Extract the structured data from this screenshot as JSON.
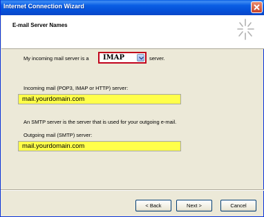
{
  "window": {
    "title": "Internet Connection Wizard"
  },
  "header": {
    "title": "E-mail Server Names",
    "icon": "wizard-sparkle-icon"
  },
  "form": {
    "incoming_prefix": "My incoming mail server is a",
    "server_type": "IMAP",
    "incoming_suffix": "server.",
    "incoming_label": "Incoming mail (POP3, IMAP or HTTP) server:",
    "incoming_value": "mail.yourdomain.com",
    "smtp_note": "An SMTP server is the server that is used for your outgoing e-mail.",
    "outgoing_label": "Outgoing mail (SMTP) server:",
    "outgoing_value": "mail.yourdomain.com",
    "highlight_color": "#ffff4a"
  },
  "buttons": {
    "back": "< Back",
    "next": "Next >",
    "cancel": "Cancel"
  }
}
